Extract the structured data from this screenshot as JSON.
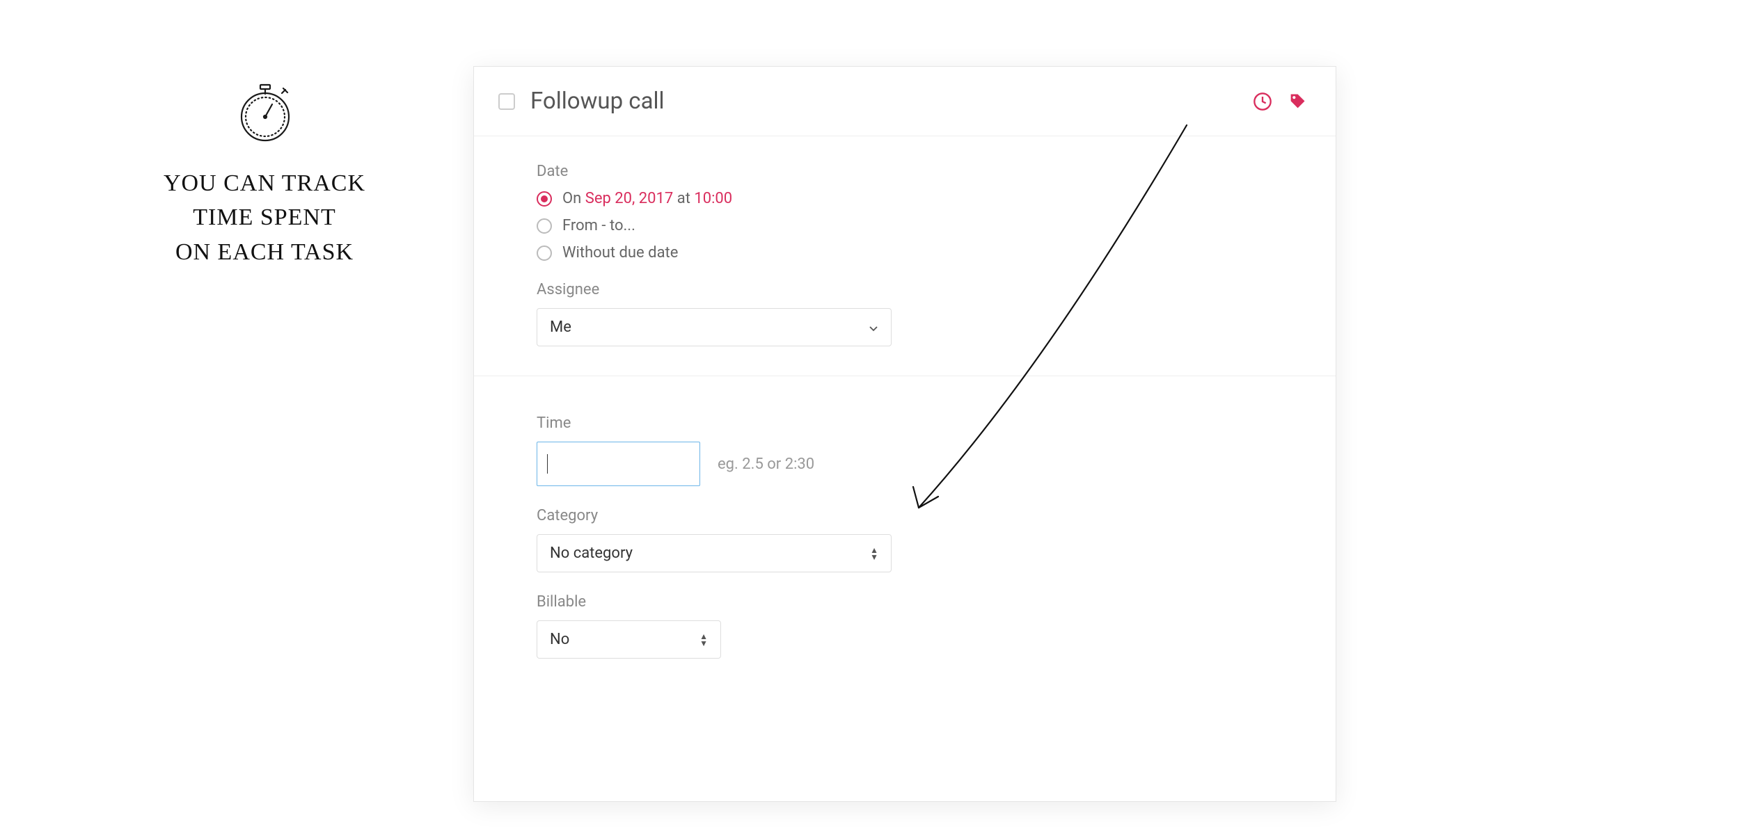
{
  "annotation": {
    "text": "YOU CAN TRACK\nTIME SPENT\nON EACH TASK"
  },
  "header": {
    "title": "Followup call"
  },
  "date": {
    "label": "Date",
    "option_on_prefix": "On ",
    "option_on_date": "Sep 20, 2017",
    "option_on_at": " at ",
    "option_on_time": "10:00",
    "option_fromto": "From - to...",
    "option_nodue": "Without due date"
  },
  "assignee": {
    "label": "Assignee",
    "value": "Me"
  },
  "time": {
    "label": "Time",
    "hint": "eg. 2.5 or 2:30",
    "value": ""
  },
  "category": {
    "label": "Category",
    "value": "No category"
  },
  "billable": {
    "label": "Billable",
    "value": "No"
  }
}
